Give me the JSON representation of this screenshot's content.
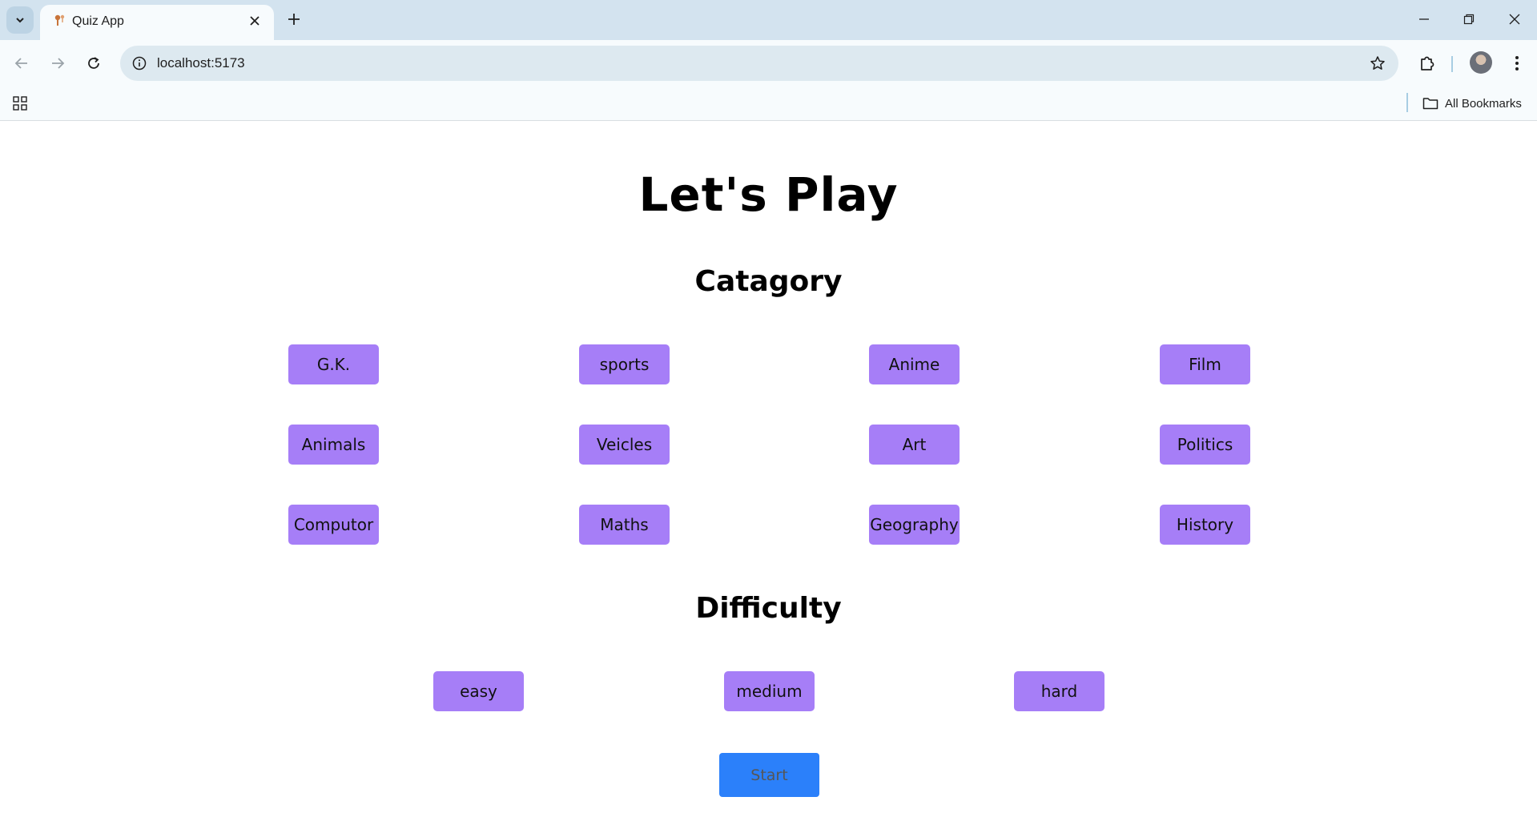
{
  "browser": {
    "tab_title": "Quiz App",
    "url": "localhost:5173",
    "all_bookmarks_label": "All Bookmarks"
  },
  "page": {
    "title": "Let's Play",
    "category_heading": "Catagory",
    "categories": [
      "G.K.",
      "sports",
      "Anime",
      "Film",
      "Animals",
      "Veicles",
      "Art",
      "Politics",
      "Computor",
      "Maths",
      "Geography",
      "History"
    ],
    "difficulty_heading": "Difficulty",
    "difficulties": [
      "easy",
      "medium",
      "hard"
    ],
    "start_label": "Start"
  },
  "colors": {
    "option_button": "#a67ef7",
    "start_button": "#2b80fa",
    "tabstrip": "#d3e3ef"
  }
}
